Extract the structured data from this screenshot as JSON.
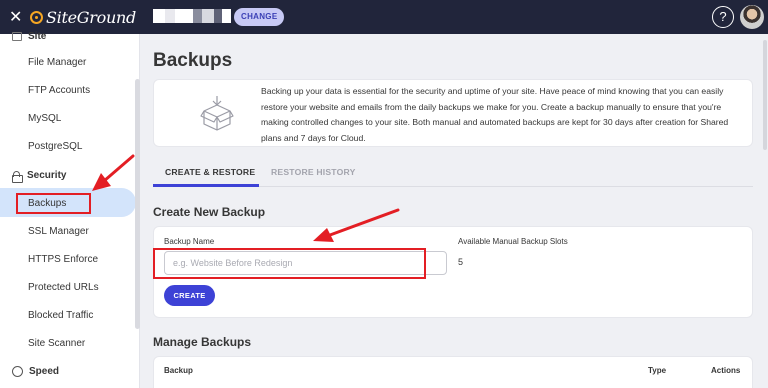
{
  "topbar": {
    "close_glyph": "✕",
    "logo_text": "SiteGround",
    "change_label": "CHANGE",
    "help_glyph": "?"
  },
  "sidebar": {
    "partial_section": "Site",
    "site_items": [
      {
        "label": "File Manager"
      },
      {
        "label": "FTP Accounts"
      },
      {
        "label": "MySQL"
      },
      {
        "label": "PostgreSQL"
      }
    ],
    "security_heading": "Security",
    "security_items": [
      {
        "label": "Backups"
      },
      {
        "label": "SSL Manager"
      },
      {
        "label": "HTTPS Enforce"
      },
      {
        "label": "Protected URLs"
      },
      {
        "label": "Blocked Traffic"
      },
      {
        "label": "Site Scanner"
      }
    ],
    "speed_heading": "Speed"
  },
  "main": {
    "title": "Backups",
    "intro_text": "Backing up your data is essential for the security and uptime of your site. Have peace of mind knowing that you can easily restore your website and emails from the daily backups we make for you. Create a backup manually to ensure that you're making controlled changes to your site. Both manual and automated backups are kept for 30 days after creation for Shared plans and 7 days for Cloud.",
    "tabs": [
      {
        "label": "CREATE & RESTORE",
        "active": true
      },
      {
        "label": "RESTORE HISTORY",
        "active": false
      }
    ],
    "create": {
      "heading": "Create New Backup",
      "name_label": "Backup Name",
      "name_placeholder": "e.g. Website Before Redesign",
      "name_value": "",
      "slots_label": "Available Manual Backup Slots",
      "slots_value": "5",
      "button_label": "CREATE"
    },
    "manage": {
      "heading": "Manage Backups",
      "columns": [
        "Backup",
        "Type",
        "Actions"
      ]
    }
  },
  "colors": {
    "topbar": "#21253b",
    "accent": "#3d42d6",
    "annotation": "#e31e24",
    "active_nav": "#d3e4fb"
  }
}
